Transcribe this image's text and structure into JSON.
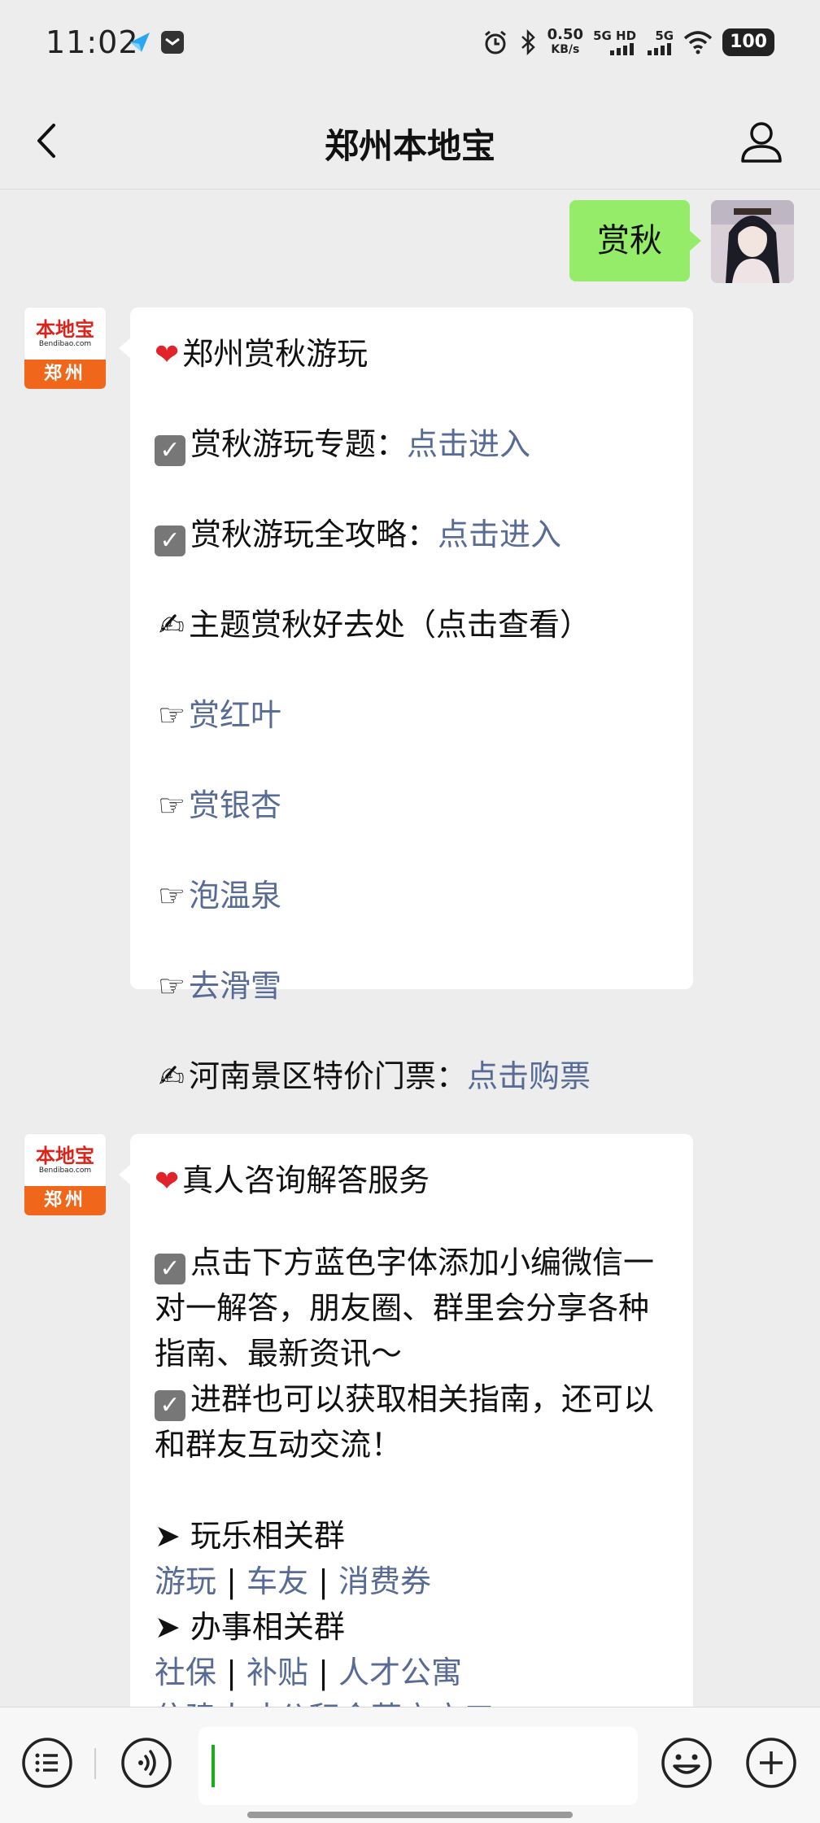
{
  "status_bar": {
    "time": "11:02",
    "speed_value": "0.50",
    "speed_unit": "KB/s",
    "net1": "5G HD",
    "net2": "5G",
    "battery": "100"
  },
  "header": {
    "title": "郑州本地宝"
  },
  "sent_message": "赏秋",
  "bot_avatar": {
    "logo_text": "本地宝",
    "logo_url": "Bendibao.com",
    "city": "郑州"
  },
  "message1": {
    "title": "郑州赏秋游玩",
    "topic_label": "赏秋游玩专题：",
    "topic_link": "点击进入",
    "guide_label": "赏秋游玩全攻略：",
    "guide_link": "点击进入",
    "places_label": "主题赏秋好去处（点击查看）",
    "places": [
      "赏红叶",
      "赏银杏",
      "泡温泉",
      "去滑雪"
    ],
    "tickets_label": "河南景区特价门票：",
    "tickets_link": "点击购票"
  },
  "message2": {
    "title": "真人咨询解答服务",
    "para1": "点击下方蓝色字体添加小编微信一对一解答，朋友圈、群里会分享各种指南、最新资讯～",
    "para2": "进群也可以获取相关指南，还可以和群友互动交流！",
    "group1_label": "➤ 玩乐相关群",
    "group1_links": [
      "游玩",
      "车友",
      "消费券"
    ],
    "group2_label": "➤ 办事相关群",
    "group2_links": [
      "社保",
      "补贴",
      "人才公寓"
    ],
    "partial_line": "住建人才公积金落户户口"
  },
  "colors": {
    "sent_bubble": "#95ec69",
    "link": "#576b95",
    "background": "#ededed"
  }
}
